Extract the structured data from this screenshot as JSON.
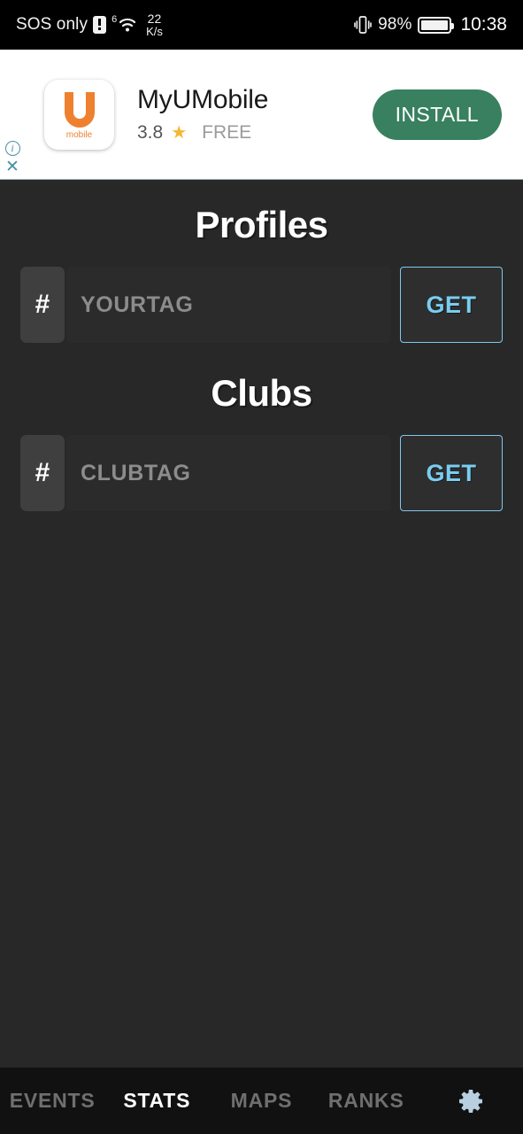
{
  "statusbar": {
    "carrier": "SOS only",
    "sim_icon": "sim-warning-icon",
    "wifi_sup": "6",
    "wifi_icon": "wifi-icon",
    "net_speed_value": "22",
    "net_speed_unit": "K/s",
    "vibrate_icon": "vibrate-icon",
    "battery_percent": "98%",
    "battery_icon": "battery-icon",
    "clock": "10:38"
  },
  "ad": {
    "info_icon": "info-icon",
    "close_icon": "close-icon",
    "app_icon_label": "mobile",
    "title": "MyUMobile",
    "rating": "3.8",
    "star_icon": "★",
    "price": "FREE",
    "install_label": "INSTALL",
    "install_color": "#38805f"
  },
  "main": {
    "sections": [
      {
        "title": "Profiles",
        "hash": "#",
        "placeholder": "YOURTAG",
        "value": "",
        "get_label": "GET"
      },
      {
        "title": "Clubs",
        "hash": "#",
        "placeholder": "CLUBTAG",
        "value": "",
        "get_label": "GET"
      }
    ],
    "accent_color": "#79cdf2"
  },
  "bottomnav": {
    "items": [
      {
        "label": "EVENTS",
        "active": false
      },
      {
        "label": "STATS",
        "active": true
      },
      {
        "label": "MAPS",
        "active": false
      },
      {
        "label": "RANKS",
        "active": false
      }
    ],
    "settings_icon": "gear-icon"
  }
}
